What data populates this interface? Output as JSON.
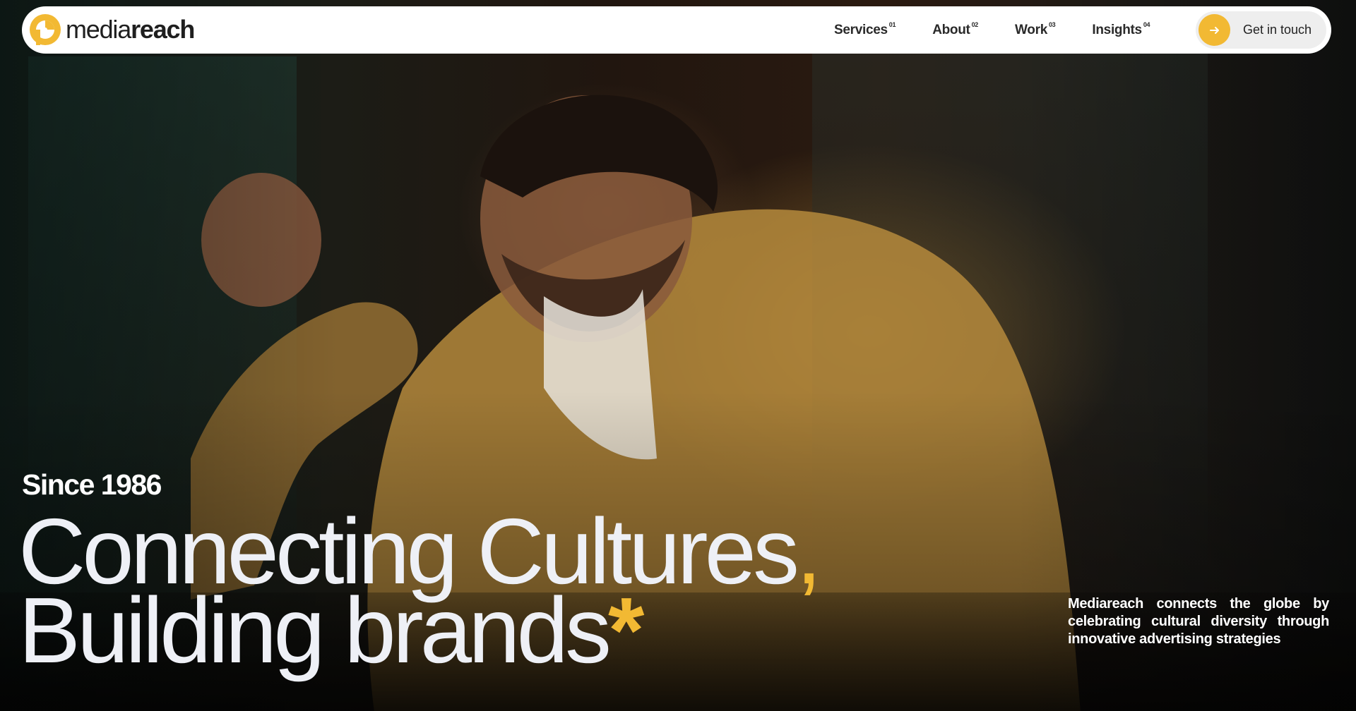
{
  "brand": {
    "logo_light": "media",
    "logo_bold": "reach",
    "accent_color": "#f2b933"
  },
  "nav": {
    "items": [
      {
        "label": "Services",
        "index": "01"
      },
      {
        "label": "About",
        "index": "02"
      },
      {
        "label": "Work",
        "index": "03"
      },
      {
        "label": "Insights",
        "index": "04"
      }
    ],
    "cta": {
      "label": "Get in touch",
      "icon": "arrow-right-icon"
    }
  },
  "hero": {
    "since": "Since 1986",
    "headline_line1": "Connecting Cultures",
    "headline_comma": ",",
    "headline_line2": "Building brands",
    "headline_asterisk": "*",
    "tagline": "Mediareach connects the globe by celebrating cultural diversity through innovative advertising strategies",
    "background": "hero-video-man-in-mustard-sweater"
  }
}
